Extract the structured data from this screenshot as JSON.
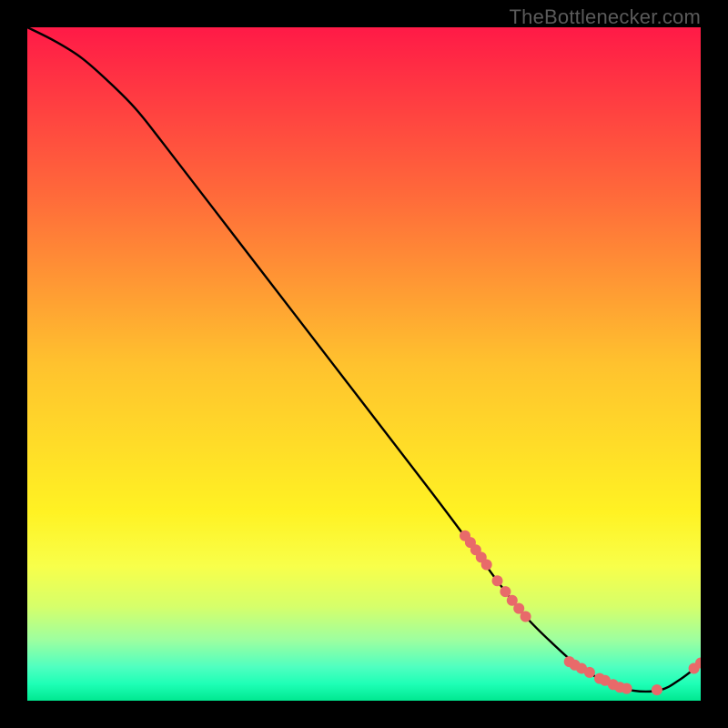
{
  "watermark": "TheBottlenecker.com",
  "chart_data": {
    "type": "line",
    "title": "",
    "xlabel": "",
    "ylabel": "",
    "xlim": [
      0,
      100
    ],
    "ylim": [
      0,
      100
    ],
    "background": {
      "gradient_stops": [
        {
          "pos": 0.0,
          "color": "#ff1a47"
        },
        {
          "pos": 0.25,
          "color": "#ff6a3a"
        },
        {
          "pos": 0.5,
          "color": "#ffc22e"
        },
        {
          "pos": 0.72,
          "color": "#fff223"
        },
        {
          "pos": 0.8,
          "color": "#f8ff4a"
        },
        {
          "pos": 0.86,
          "color": "#d6ff6a"
        },
        {
          "pos": 0.91,
          "color": "#9dffa0"
        },
        {
          "pos": 0.95,
          "color": "#4fffc0"
        },
        {
          "pos": 0.975,
          "color": "#1effb6"
        },
        {
          "pos": 1.0,
          "color": "#00e890"
        }
      ]
    },
    "series": [
      {
        "name": "bottleneck-curve",
        "color": "#000000",
        "x": [
          0,
          4,
          8,
          12,
          16,
          20,
          30,
          40,
          50,
          60,
          66,
          70,
          74,
          78,
          82,
          86,
          90,
          94,
          97,
          100
        ],
        "y": [
          100,
          98,
          95.5,
          92,
          88,
          83,
          70,
          57,
          44,
          31,
          23,
          17.5,
          12.5,
          8.5,
          5,
          2.8,
          1.5,
          1.6,
          3.2,
          5.5
        ]
      }
    ],
    "markers": {
      "name": "highlighted-points",
      "color": "#e86a6a",
      "radius": 6,
      "points": [
        {
          "x": 65.0,
          "y": 24.5
        },
        {
          "x": 65.8,
          "y": 23.5
        },
        {
          "x": 66.6,
          "y": 22.4
        },
        {
          "x": 67.4,
          "y": 21.3
        },
        {
          "x": 68.2,
          "y": 20.2
        },
        {
          "x": 69.8,
          "y": 17.8
        },
        {
          "x": 71.0,
          "y": 16.2
        },
        {
          "x": 72.0,
          "y": 14.9
        },
        {
          "x": 73.0,
          "y": 13.7
        },
        {
          "x": 74.0,
          "y": 12.5
        },
        {
          "x": 80.5,
          "y": 5.8
        },
        {
          "x": 81.3,
          "y": 5.3
        },
        {
          "x": 82.3,
          "y": 4.8
        },
        {
          "x": 83.5,
          "y": 4.2
        },
        {
          "x": 85.0,
          "y": 3.3
        },
        {
          "x": 85.8,
          "y": 3.0
        },
        {
          "x": 87.0,
          "y": 2.4
        },
        {
          "x": 88.0,
          "y": 2.0
        },
        {
          "x": 89.0,
          "y": 1.8
        },
        {
          "x": 93.5,
          "y": 1.6
        },
        {
          "x": 99.0,
          "y": 4.8
        },
        {
          "x": 100.0,
          "y": 5.6
        }
      ]
    }
  }
}
